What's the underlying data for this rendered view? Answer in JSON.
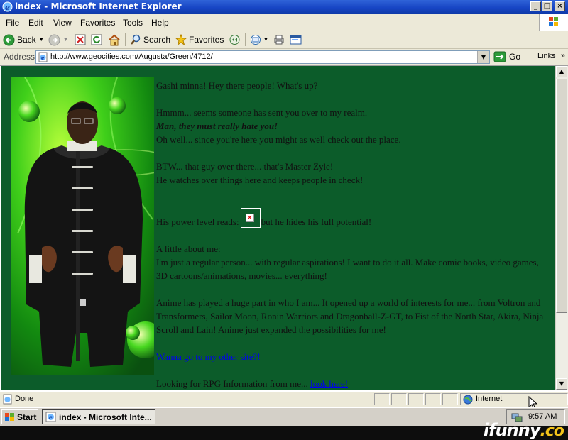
{
  "window": {
    "title": "index - Microsoft Internet Explorer",
    "buttons": [
      "_",
      "□",
      "×"
    ]
  },
  "menu": [
    "File",
    "Edit",
    "View",
    "Favorites",
    "Tools",
    "Help"
  ],
  "toolbar": {
    "back_label": "Back",
    "search_label": "Search",
    "favorites_label": "Favorites"
  },
  "address": {
    "label": "Address",
    "url": "http://www.geocities.com/Augusta/Green/4712/",
    "go_label": "Go",
    "links_label": "Links",
    "links_chevron": "»"
  },
  "page": {
    "background": "#0c5c2a",
    "link_color": "#0000ee",
    "greeting": "Gashi minna! Hey there people! What's up?",
    "realm_line": "Hmmm... seems someone has sent you over to my realm.",
    "hate_line": "Man, they must really hate you!",
    "check_line": "Oh well... since you're here you might as well check out the place.",
    "btw_line": "BTW... that guy over there... that's Master Zyle!",
    "watch_line": "He watches over things here and keeps people in check!",
    "power_prefix": "His power level reads:",
    "power_suffix": "k, but he hides his full potential!",
    "about_heading": "A little about me:",
    "about_text": "I'm just a regular person... with regular aspirations! I want to do it all. Make comic books, video games, 3D cartoons/animations, movies... everything!",
    "anime_text": "Anime has played a huge part in who I am... It opened up a world of interests for me... from Voltron and Transformers, Sailor Moon, Ronin Warriors and Dragonball-Z-GT, to Fist of the North Star, Akira, Ninja Scroll and Lain! Anime just expanded the possibilities for me!",
    "other_site_link": "Wanna go to my other site?!",
    "rpg_prefix": "Looking for RPG Information from me...",
    "rpg_link": "look here!"
  },
  "status": {
    "text": "Done",
    "zone": "Internet"
  },
  "taskbar": {
    "start_label": "Start",
    "task_label": "index - Microsoft Inte...",
    "clock": "9:57 AM"
  },
  "watermark": {
    "main": "ifunny",
    "suffix": ".co"
  },
  "icons": [
    "ie-icon",
    "back-icon",
    "forward-icon",
    "stop-icon",
    "refresh-icon",
    "home-icon",
    "search-icon",
    "favorites-icon",
    "media-icon",
    "mail-icon",
    "print-icon",
    "edit-icon",
    "page-icon",
    "go-icon",
    "broken-image-icon",
    "windows-logo-icon",
    "start-flag-icon",
    "network-icon",
    "cursor-icon"
  ]
}
